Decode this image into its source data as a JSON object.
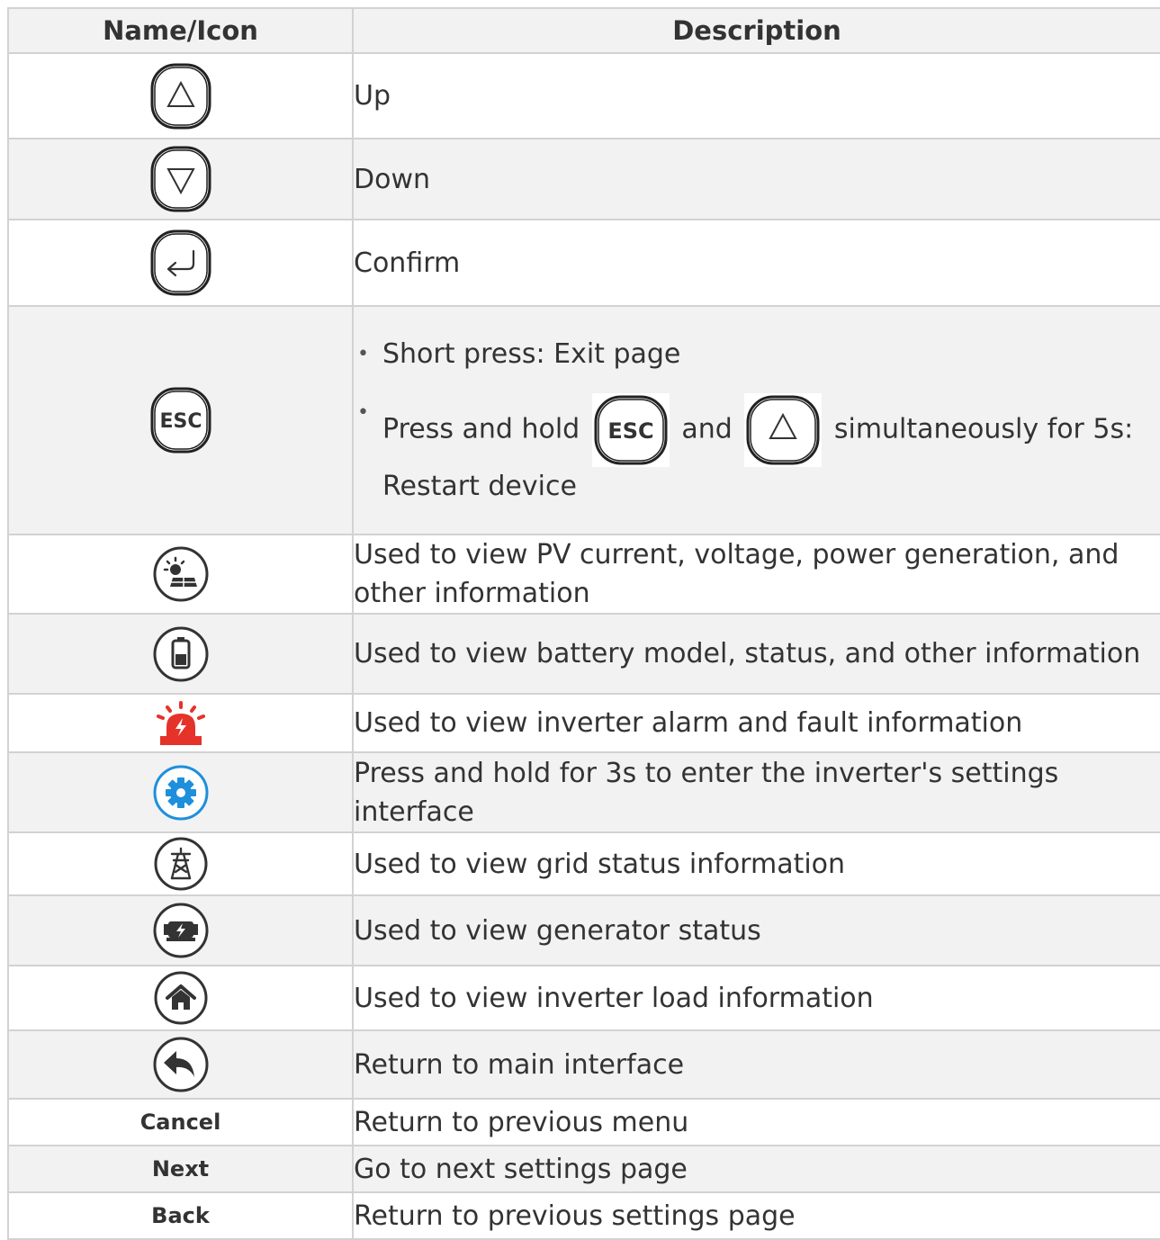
{
  "header": {
    "col_name": "Name/Icon",
    "col_desc": "Description"
  },
  "rows": [
    {
      "icon": "up-arrow-key-icon",
      "desc": "Up"
    },
    {
      "icon": "down-arrow-key-icon",
      "desc": "Down"
    },
    {
      "icon": "enter-key-icon",
      "desc": "Confirm"
    },
    {
      "icon": "esc-key-icon",
      "desc_items": [
        "Short press: Exit page"
      ],
      "press_hold": {
        "prefix": "Press and hold",
        "key1": "ESC",
        "conj": "and",
        "suffix": "simultaneously for 5s:",
        "line2": "Restart device"
      }
    },
    {
      "icon": "pv-sun-panel-icon",
      "desc": "Used to view PV current, voltage, power generation, and other information"
    },
    {
      "icon": "battery-icon",
      "desc": "Used to view battery model, status, and other information"
    },
    {
      "icon": "alarm-siren-icon",
      "desc": "Used to view inverter alarm and fault information",
      "color": "#e5332a"
    },
    {
      "icon": "gear-icon",
      "desc": "Press and hold for 3s to enter the inverter's settings interface",
      "color": "#1e8fdc"
    },
    {
      "icon": "grid-tower-icon",
      "desc": "Used to view grid status information"
    },
    {
      "icon": "generator-icon",
      "desc": "Used to view generator status"
    },
    {
      "icon": "home-icon",
      "desc": "Used to view inverter load information"
    },
    {
      "icon": "return-arrow-icon",
      "desc": "Return to main interface"
    },
    {
      "name": "Cancel",
      "desc": "Return to previous menu"
    },
    {
      "name": "Next",
      "desc": "Go to next settings page"
    },
    {
      "name": "Back",
      "desc": "Return to previous settings page"
    }
  ]
}
